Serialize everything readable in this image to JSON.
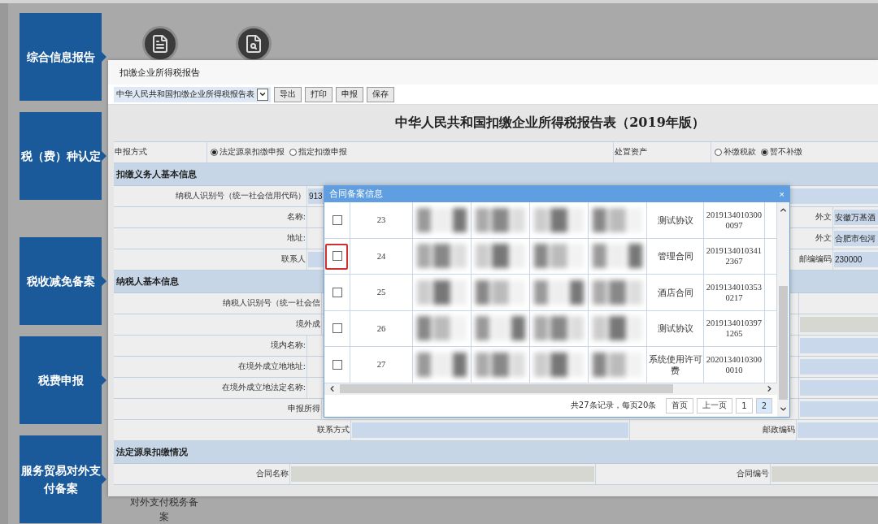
{
  "sidebar": {
    "groups": [
      {
        "items": [
          {
            "label": "综合信息报告"
          },
          {
            "label": "税（费）种认定"
          }
        ]
      },
      {
        "items": [
          {
            "label": "税收减免备案"
          },
          {
            "label": "税费申报"
          },
          {
            "label": "服务贸易对外支付备案"
          }
        ]
      }
    ]
  },
  "main": {
    "icons": [
      {
        "kind": "document"
      },
      {
        "kind": "search"
      }
    ],
    "caption": "对外支付税务备案"
  },
  "report_window": {
    "title": "扣缴企业所得税报告",
    "toolbar": {
      "select": {
        "value": "中华人民共和国扣缴企业所得税报告表"
      },
      "buttons": [
        "导出",
        "打印",
        "申报",
        "保存"
      ]
    },
    "heading": "中华人民共和国扣缴企业所得税报告表（2019年版）",
    "rows": [
      {
        "kind": "radio_row",
        "cells": [
          {
            "kind": "label_left",
            "text": "申报方式"
          },
          {
            "kind": "radios",
            "options": [
              {
                "label": "法定源泉扣缴申报",
                "selected": true
              },
              {
                "label": "指定扣缴申报",
                "selected": false
              }
            ]
          },
          {
            "kind": "label_left",
            "text": "处置资产"
          },
          {
            "kind": "radios",
            "options": [
              {
                "label": "补缴税款",
                "selected": false
              },
              {
                "label": "暂不补缴",
                "selected": true
              }
            ]
          }
        ]
      },
      {
        "kind": "section",
        "title": "扣缴义务人基本信息"
      },
      {
        "kind": "pair",
        "cells": [
          {
            "kind": "label",
            "text": "纳税人识别号（统一社会信用代码）"
          },
          {
            "kind": "input",
            "value": "913",
            "readonly": false
          }
        ]
      },
      {
        "kind": "quad",
        "cells": [
          {
            "kind": "label",
            "text": "名称:"
          },
          {
            "kind": "blank"
          },
          {
            "kind": "label",
            "text": "外文"
          },
          {
            "kind": "input",
            "value": "安徽万基酒",
            "readonly": false
          }
        ]
      },
      {
        "kind": "quad",
        "cells": [
          {
            "kind": "label",
            "text": "地址:"
          },
          {
            "kind": "blank"
          },
          {
            "kind": "label",
            "text": "外文"
          },
          {
            "kind": "input",
            "value": "合肥市包河",
            "readonly": false
          }
        ]
      },
      {
        "kind": "quad",
        "cells": [
          {
            "kind": "label",
            "text": "联系人"
          },
          {
            "kind": "input",
            "readonly": false
          },
          {
            "kind": "label",
            "text": "邮编编码"
          },
          {
            "kind": "input",
            "value": "230000",
            "readonly": false
          }
        ]
      },
      {
        "kind": "section",
        "title": "纳税人基本信息"
      },
      {
        "kind": "cut",
        "cells": [
          {
            "kind": "label",
            "text": "纳税人识别号（统一社会信"
          },
          {
            "kind": "blank"
          },
          {
            "kind": "blank"
          }
        ]
      },
      {
        "kind": "cut",
        "cells": [
          {
            "kind": "label",
            "text": "境外成"
          },
          {
            "kind": "blank"
          },
          {
            "kind": "input",
            "readonly": true
          }
        ]
      },
      {
        "kind": "triple",
        "cells": [
          {
            "kind": "label",
            "text": "境内名称:"
          },
          {
            "kind": "blank"
          },
          {
            "kind": "input",
            "readonly": false
          }
        ]
      },
      {
        "kind": "triple",
        "cells": [
          {
            "kind": "label",
            "text": "在境外成立地地址:"
          },
          {
            "kind": "blank"
          },
          {
            "kind": "input",
            "readonly": false
          }
        ]
      },
      {
        "kind": "triple",
        "cells": [
          {
            "kind": "label",
            "text": "在境外成立地法定名称:"
          },
          {
            "kind": "blank"
          },
          {
            "kind": "input",
            "readonly": false
          }
        ]
      },
      {
        "kind": "cut",
        "cells": [
          {
            "kind": "label",
            "text": "申报所得"
          },
          {
            "kind": "blank"
          },
          {
            "kind": "input",
            "readonly": false
          }
        ]
      },
      {
        "kind": "contact",
        "cells": [
          {
            "kind": "label",
            "text": "联系方式"
          },
          {
            "kind": "input",
            "readonly": false
          },
          {
            "kind": "label",
            "text": "邮政编码"
          },
          {
            "kind": "input",
            "readonly": false
          }
        ]
      },
      {
        "kind": "section",
        "title": "法定源泉扣缴情况"
      },
      {
        "kind": "contract",
        "cells": [
          {
            "kind": "label",
            "text": "合同名称"
          },
          {
            "kind": "input",
            "readonly": true
          },
          {
            "kind": "label",
            "text": "合同编号"
          },
          {
            "kind": "input",
            "readonly": true
          }
        ]
      }
    ]
  },
  "contract_dialog": {
    "title": "合同备案信息",
    "close": "×",
    "rows": [
      {
        "number": "23",
        "type": "测试协议",
        "code": "20191340103000097",
        "checked": false,
        "highlighted": false
      },
      {
        "number": "24",
        "type": "管理合同",
        "code": "20191340103412367",
        "checked": false,
        "highlighted": true
      },
      {
        "number": "25",
        "type": "酒店合同",
        "code": "20191340103530217",
        "checked": false,
        "highlighted": false
      },
      {
        "number": "26",
        "type": "测试协议",
        "code": "20191340103971265",
        "checked": false,
        "highlighted": false
      },
      {
        "number": "27",
        "type": "系统使用许可费",
        "code": "20201340103000010",
        "checked": false,
        "highlighted": false
      }
    ],
    "summary": "共27条记录，每页20条",
    "pager": {
      "buttons": [
        "首页",
        "上一页"
      ],
      "pages": [
        {
          "label": "1",
          "selected": false
        },
        {
          "label": "2",
          "selected": true
        }
      ]
    }
  }
}
